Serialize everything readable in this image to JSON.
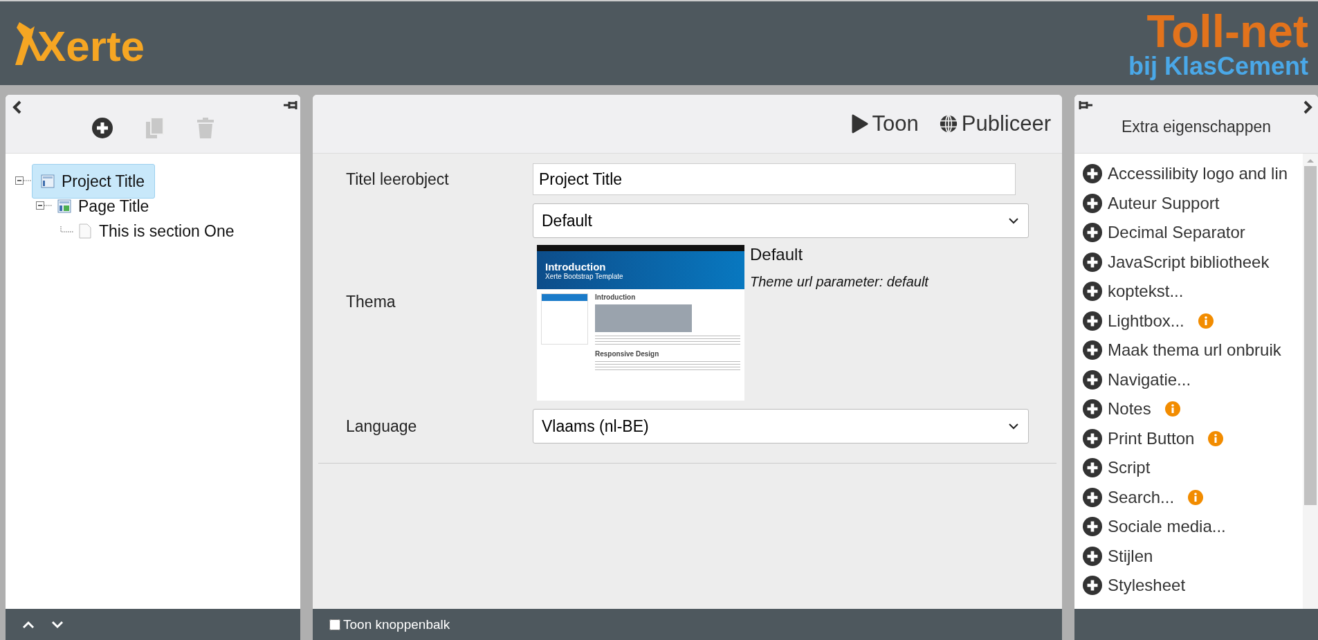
{
  "header": {
    "logo": "Xerte",
    "brand": "Toll-net",
    "brand_sub": "bij KlasCement"
  },
  "tree_panel": {
    "tree": [
      {
        "label": "Project Title",
        "kind": "project",
        "selected": true,
        "expanded": true,
        "children": [
          {
            "label": "Page Title",
            "kind": "page",
            "selected": false,
            "expanded": true,
            "children": [
              {
                "label": "This is section One",
                "kind": "section",
                "selected": false
              }
            ]
          }
        ]
      }
    ]
  },
  "editor": {
    "actions": [
      {
        "label": "Toon",
        "kind": "play"
      },
      {
        "label": "Publiceer",
        "kind": "globe"
      }
    ],
    "fields": [
      {
        "label": "Titel leerobject",
        "kind": "text",
        "value": "Project Title"
      },
      {
        "label": "Thema",
        "kind": "theme",
        "value": "Default",
        "theme_name": "Default",
        "theme_note": "Theme url parameter: default",
        "preview": {
          "title": "Introduction",
          "subtitle": "Xerte Bootstrap Template",
          "heading": "Introduction",
          "heading2": "Responsive Design"
        }
      },
      {
        "label": "Language",
        "kind": "select",
        "value": "Vlaams (nl-BE)"
      }
    ],
    "toolbar_toggle": {
      "label": "Toon knoppenbalk",
      "checked": false
    }
  },
  "extra_panel": {
    "title": "Extra eigenschappen",
    "items": [
      {
        "label": "Accessilibity logo and lin",
        "info": false
      },
      {
        "label": "Auteur Support",
        "info": false
      },
      {
        "label": "Decimal Separator",
        "info": false
      },
      {
        "label": "JavaScript bibliotheek",
        "info": false
      },
      {
        "label": "koptekst...",
        "info": false
      },
      {
        "label": "Lightbox...",
        "info": true
      },
      {
        "label": "Maak thema url onbruik",
        "info": false
      },
      {
        "label": "Navigatie...",
        "info": false
      },
      {
        "label": "Notes",
        "info": true
      },
      {
        "label": "Print Button",
        "info": true
      },
      {
        "label": "Script",
        "info": false
      },
      {
        "label": "Search...",
        "info": true
      },
      {
        "label": "Sociale media...",
        "info": false
      },
      {
        "label": "Stijlen",
        "info": false
      },
      {
        "label": "Stylesheet",
        "info": false
      }
    ]
  }
}
